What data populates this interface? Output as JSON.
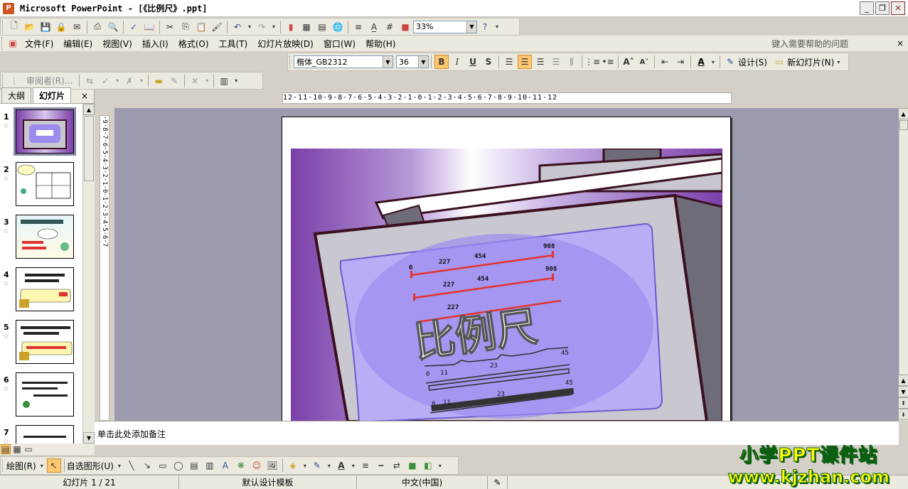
{
  "window": {
    "title": "Microsoft PowerPoint - [《比例尺》.ppt]",
    "minimize": "_",
    "restore": "❐",
    "close": "✕"
  },
  "toolbar": {
    "zoom": "33%",
    "font_name": "楷体_GB2312",
    "font_size": "36",
    "bold": "B",
    "italic": "I",
    "underline": "U",
    "shadow": "S",
    "design_label": "设计(S)",
    "new_slide_label": "新幻灯片(N)",
    "reviewer_label": "审阅者(R)..."
  },
  "menu": {
    "items": [
      "文件(F)",
      "编辑(E)",
      "视图(V)",
      "插入(I)",
      "格式(O)",
      "工具(T)",
      "幻灯片放映(D)",
      "窗口(W)",
      "帮助(H)"
    ],
    "help_placeholder": "键入需要帮助的问题",
    "close": "×"
  },
  "side_panel": {
    "tabs": [
      "大纲",
      "幻灯片"
    ],
    "active_tab": "幻灯片",
    "close": "×",
    "slides": [
      "1",
      "2",
      "3",
      "4",
      "5",
      "6",
      "7"
    ],
    "selected_slide": "1",
    "star": "☆"
  },
  "ruler": {
    "horizontal": "12·11·10·9·8·7·6·5·4·3·2·1·0·1·2·3·4·5·6·7·8·9·10·11·12",
    "vertical": "·9·8·7·6·5·4·3·2·1·0·1·2·3·4·5·6·7"
  },
  "slide": {
    "title_text": "比例尺",
    "scale_marks": [
      "0",
      "227",
      "454",
      "908"
    ],
    "gauge_marks": [
      "0",
      "11",
      "23",
      "45"
    ]
  },
  "notes": {
    "placeholder": "单击此处添加备注"
  },
  "drawing_toolbar": {
    "draw_label": "绘图(R)",
    "autoshapes_label": "自选图形(U)"
  },
  "status": {
    "slide_position": "幻灯片 1 / 21",
    "template": "默认设计模板",
    "language": "中文(中国)"
  },
  "watermark": {
    "line1": "小学PPT课件站",
    "line2": "www.kjzhan.com"
  },
  "colors": {
    "slide_purple": "#7b3fa8",
    "slide_screen": "#9d8cf0",
    "ruler_red": "#e4332c",
    "watermark_yellow": "#ffff00",
    "watermark_green": "#0b5e12"
  }
}
